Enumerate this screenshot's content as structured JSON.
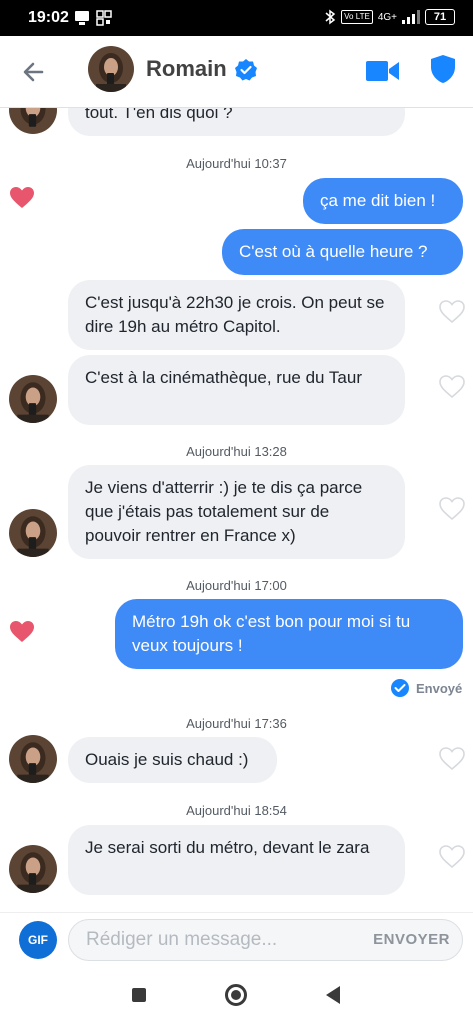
{
  "status_bar": {
    "time": "19:02",
    "network": "4G+",
    "volte": "Vo LTE",
    "battery": "71"
  },
  "header": {
    "contact_name": "Romain",
    "verified": true,
    "accent_color": "#1786ff"
  },
  "chat": {
    "messages": [
      {
        "type": "incoming",
        "text": "tout. T'en dis quoi ?"
      },
      {
        "type": "timestamp",
        "text": "Aujourd'hui 10:37"
      },
      {
        "type": "outgoing",
        "text": "ça me dit bien !",
        "liked": true
      },
      {
        "type": "outgoing",
        "text": "C'est où à quelle heure ?"
      },
      {
        "type": "incoming",
        "text": "C'est jusqu'à 22h30 je crois. On peut se dire 19h au métro Capitol."
      },
      {
        "type": "incoming",
        "text": "C'est à la cinémathèque, rue du Taur"
      },
      {
        "type": "timestamp",
        "text": "Aujourd'hui 13:28"
      },
      {
        "type": "incoming",
        "text": "Je viens d'atterrir :) je te dis ça parce que j'étais pas totalement sur de pouvoir rentrer en France x)"
      },
      {
        "type": "timestamp",
        "text": "Aujourd'hui 17:00"
      },
      {
        "type": "outgoing",
        "text": "Métro 19h ok c'est bon pour moi si tu veux toujours !",
        "liked": true
      },
      {
        "type": "status",
        "text": "Envoyé"
      },
      {
        "type": "timestamp",
        "text": "Aujourd'hui 17:36"
      },
      {
        "type": "incoming",
        "text": "Ouais je suis chaud :)"
      },
      {
        "type": "timestamp",
        "text": "Aujourd'hui 18:54"
      },
      {
        "type": "incoming",
        "text": "Je serai sorti du métro, devant le zara"
      }
    ]
  },
  "composer": {
    "gif_label": "GIF",
    "placeholder": "Rédiger un message...",
    "send_label": "ENVOYER"
  },
  "colors": {
    "outgoing_bubble": "#3e8af7",
    "incoming_bubble": "#eef0f3",
    "like_heart": "#e8566d"
  }
}
